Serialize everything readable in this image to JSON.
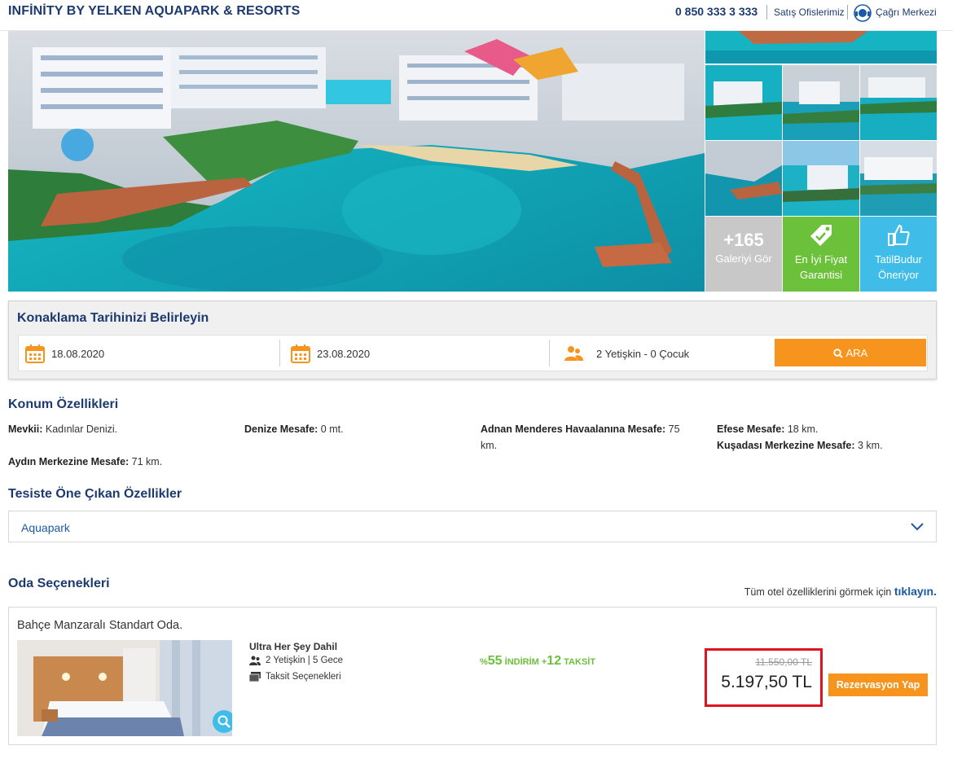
{
  "header": {
    "title": "INFİNİTY BY YELKEN AQUAPARK & RESORTS",
    "phone": "0 850 333 3 333",
    "sales_offices": "Satış Ofislerimiz",
    "call_center": "Çağrı Merkezi"
  },
  "gallery": {
    "more_count": "+165",
    "more_label": "Galeriyi Gör",
    "best_price_label": "En İyi Fiyat Garantisi",
    "recommend_label": "TatilBudur Öneriyor"
  },
  "search": {
    "title": "Konaklama Tarihinizi Belirleyin",
    "checkin": "18.08.2020",
    "checkout": "23.08.2020",
    "guests": "2 Yetişkin - 0 Çocuk",
    "button": "ARA"
  },
  "location": {
    "title": "Konum Özellikleri",
    "items": [
      {
        "label": "Mevkii:",
        "value": " Kadınlar Denizi."
      },
      {
        "label": "Denize Mesafe:",
        "value": " 0 mt."
      },
      {
        "label": "Adnan Menderes Havaalanına Mesafe:",
        "value": " 75 km."
      },
      {
        "label": "Efese Mesafe:",
        "value": " 18 km."
      },
      {
        "label": "Kuşadası Merkezine Mesafe:",
        "value": " 3 km."
      },
      {
        "label": "Aydın Merkezine Mesafe:",
        "value": " 71 km."
      }
    ]
  },
  "highlights": {
    "title": "Tesiste Öne Çıkan Özellikler",
    "selected": "Aquapark"
  },
  "rooms": {
    "title": "Oda Seçenekleri",
    "all_features_text": "Tüm otel özelliklerini görmek için ",
    "all_features_link": "tıklayın.",
    "card": {
      "name": "Bahçe Manzaralı Standart Oda.",
      "board": "Ultra Her Şey Dahil",
      "occupancy": "2 Yetişkin | 5 Gece",
      "installments": "Taksit Seçenekleri",
      "discount_prefix": "%",
      "discount_pct": "55",
      "discount_word": " İNDİRİM ",
      "installment_plus": "+",
      "installment_count": "12",
      "installment_word": " TAKSİT",
      "old_price": "11.550,00 TL",
      "new_price": "5.197,50 TL",
      "reserve": "Rezervasyon Yap"
    }
  },
  "colors": {
    "brand_navy": "#1c3a70",
    "accent_orange": "#f7941d",
    "green": "#6cc13a",
    "light_blue": "#3fbde8",
    "highlight_red": "#e0141e"
  }
}
